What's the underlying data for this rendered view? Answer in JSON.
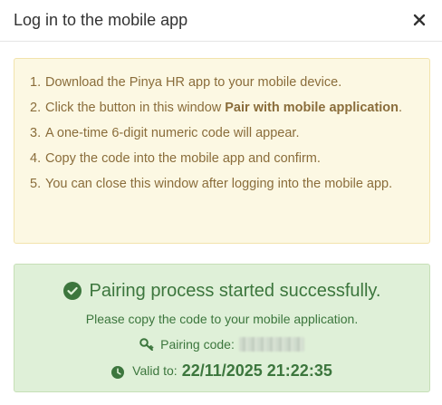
{
  "dialog": {
    "title": "Log in to the mobile app",
    "close_icon": "close-icon"
  },
  "steps": [
    {
      "num": "1.",
      "text": "Download the Pinya HR app to your mobile device.",
      "bold": ""
    },
    {
      "num": "2.",
      "text": "Click the button in this window ",
      "bold": "Pair with mobile application",
      "after": "."
    },
    {
      "num": "3.",
      "text": "A one-time 6-digit numeric code will appear.",
      "bold": ""
    },
    {
      "num": "4.",
      "text": "Copy the code into the mobile app and confirm.",
      "bold": ""
    },
    {
      "num": "5.",
      "text": "You can close this window after logging into the mobile app.",
      "bold": ""
    }
  ],
  "success": {
    "headline": "Pairing process started successfully.",
    "subtext": "Please copy the code to your mobile application.",
    "code_label": "Pairing code:",
    "valid_label": "Valid to:",
    "valid_until": "22/11/2025 21:22:35",
    "icons": [
      "check-circle-icon",
      "key-icon",
      "clock-icon"
    ]
  },
  "colors": {
    "warning_bg": "#fcf8e3",
    "warning_text": "#8a6d3b",
    "success_bg": "#dff0d8",
    "success_text": "#3c763d"
  }
}
